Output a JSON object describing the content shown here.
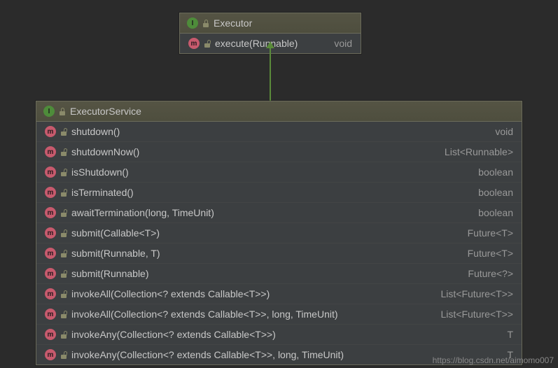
{
  "executor": {
    "name": "Executor",
    "methods": [
      {
        "sig": "execute(Runnable)",
        "ret": "void"
      }
    ]
  },
  "service": {
    "name": "ExecutorService",
    "methods": [
      {
        "sig": "shutdown()",
        "ret": "void"
      },
      {
        "sig": "shutdownNow()",
        "ret": "List<Runnable>"
      },
      {
        "sig": "isShutdown()",
        "ret": "boolean"
      },
      {
        "sig": "isTerminated()",
        "ret": "boolean"
      },
      {
        "sig": "awaitTermination(long, TimeUnit)",
        "ret": "boolean"
      },
      {
        "sig": "submit(Callable<T>)",
        "ret": "Future<T>"
      },
      {
        "sig": "submit(Runnable, T)",
        "ret": "Future<T>"
      },
      {
        "sig": "submit(Runnable)",
        "ret": "Future<?>"
      },
      {
        "sig": "invokeAll(Collection<? extends Callable<T>>)",
        "ret": "List<Future<T>>"
      },
      {
        "sig": "invokeAll(Collection<? extends Callable<T>>, long, TimeUnit)",
        "ret": "List<Future<T>>"
      },
      {
        "sig": "invokeAny(Collection<? extends Callable<T>>)",
        "ret": "T"
      },
      {
        "sig": "invokeAny(Collection<? extends Callable<T>>, long, TimeUnit)",
        "ret": "T"
      }
    ]
  },
  "watermark": "https://blog.csdn.net/aimomo007"
}
